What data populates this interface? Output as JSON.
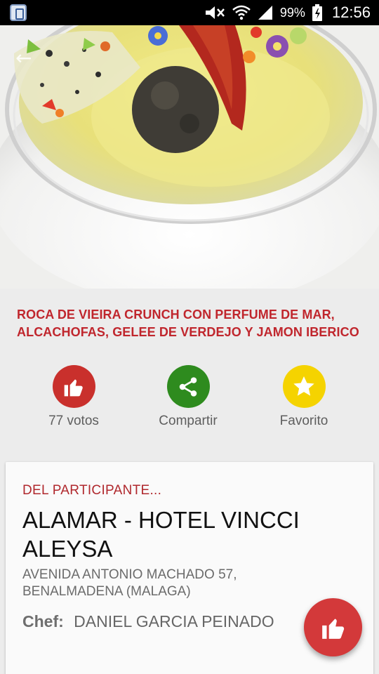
{
  "status_bar": {
    "battery_percent": "99%",
    "time": "12:56"
  },
  "dish": {
    "title": "ROCA DE VIEIRA CRUNCH CON PERFUME DE MAR, ALCACHOFAS, GELEE DE VERDEJO Y JAMON IBERICO"
  },
  "actions": {
    "votes_label": "77 votos",
    "share_label": "Compartir",
    "favorite_label": "Favorito"
  },
  "participant": {
    "section_label": "DEL PARTICIPANTE...",
    "name": "ALAMAR - HOTEL VINCCI ALEYSA",
    "address": "AVENIDA ANTONIO MACHADO 57, BENALMADENA (MALAGA)",
    "chef_label": "Chef:",
    "chef_name": "DANIEL GARCIA PEINADO"
  },
  "colors": {
    "accent_red": "#c0262d",
    "vote_red": "#c9302c",
    "share_green": "#2e8b1e",
    "favorite_yellow": "#f5d300",
    "background": "#ececec"
  },
  "icons": {
    "vote": "thumbs-up-icon",
    "share": "share-icon",
    "favorite": "star-icon",
    "fab": "thumbs-up-icon"
  }
}
